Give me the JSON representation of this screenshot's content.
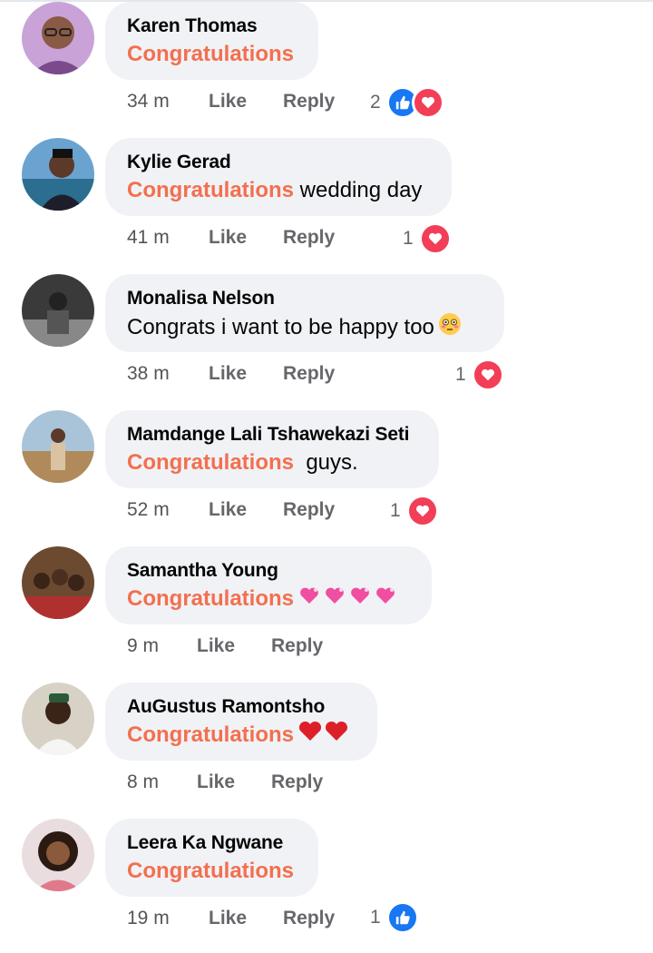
{
  "comments": [
    {
      "author": "Karen Thomas",
      "keyword": "Congratulations",
      "rest": "",
      "time": "34 m",
      "like": "Like",
      "reply": "Reply",
      "reactions": {
        "count": "2",
        "icons": [
          "like-icon",
          "love-icon"
        ]
      }
    },
    {
      "author": "Kylie Gerad",
      "keyword": "Congratulations",
      "rest": " wedding day",
      "time": "41 m",
      "like": "Like",
      "reply": "Reply",
      "reactions": {
        "count": "1",
        "icons": [
          "love-icon"
        ]
      }
    },
    {
      "author": "Monalisa Nelson",
      "keyword": "",
      "rest": "Congrats i want to be happy too",
      "emoji": "flushed-face",
      "time": "38 m",
      "like": "Like",
      "reply": "Reply",
      "reactions": {
        "count": "1",
        "icons": [
          "love-icon"
        ]
      }
    },
    {
      "author": "Mamdange Lali Tshawekazi Seti",
      "keyword": "Congratulations",
      "rest": "  guys.",
      "time": "52 m",
      "like": "Like",
      "reply": "Reply",
      "reactions": {
        "count": "1",
        "icons": [
          "love-icon"
        ]
      }
    },
    {
      "author": "Samantha Young",
      "keyword": "Congratulations",
      "rest": " ",
      "emoji": "sparkling-heart x4",
      "time": "9 m",
      "like": "Like",
      "reply": "Reply",
      "reactions": null
    },
    {
      "author": "AuGustus Ramontsho",
      "keyword": "Congratulations",
      "rest": " ",
      "emoji": "red-heart x2",
      "time": "8 m",
      "like": "Like",
      "reply": "Reply",
      "reactions": null
    },
    {
      "author": "Leera Ka Ngwane",
      "keyword": "Congratulations",
      "rest": "",
      "time": "19 m",
      "like": "Like",
      "reply": "Reply",
      "reactions": {
        "count": "1",
        "icons": [
          "like-icon"
        ]
      }
    }
  ],
  "colors": {
    "keyword": "#f36f4f",
    "bubble": "#f0f2f5",
    "like_blue": "#1877f2",
    "love_red": "#f33e58",
    "meta_gray": "#65676b"
  }
}
